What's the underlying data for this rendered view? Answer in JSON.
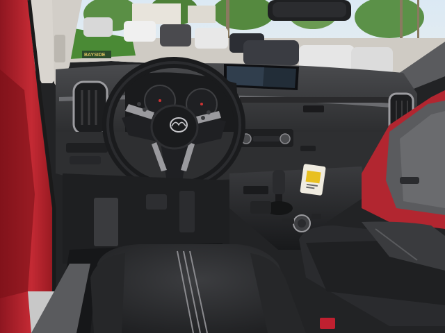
{
  "scene": {
    "subject": "car-interior-dashboard",
    "colors": {
      "body_paint": "#b3202a",
      "body_paint_dark": "#7a1018",
      "dash": "#3a3b3d",
      "dash_dark": "#202123",
      "seat": "#2e2f31",
      "sky": "#cfe2f0",
      "foliage": "#4f8a3a",
      "trim": "#b8b8b8",
      "hang_tag": "#f0ece0",
      "hang_tag_accent": "#e8c020"
    },
    "steering_wheel_emblem": "mazda-logo",
    "windshield_plate_text": "BAYSIDE"
  }
}
